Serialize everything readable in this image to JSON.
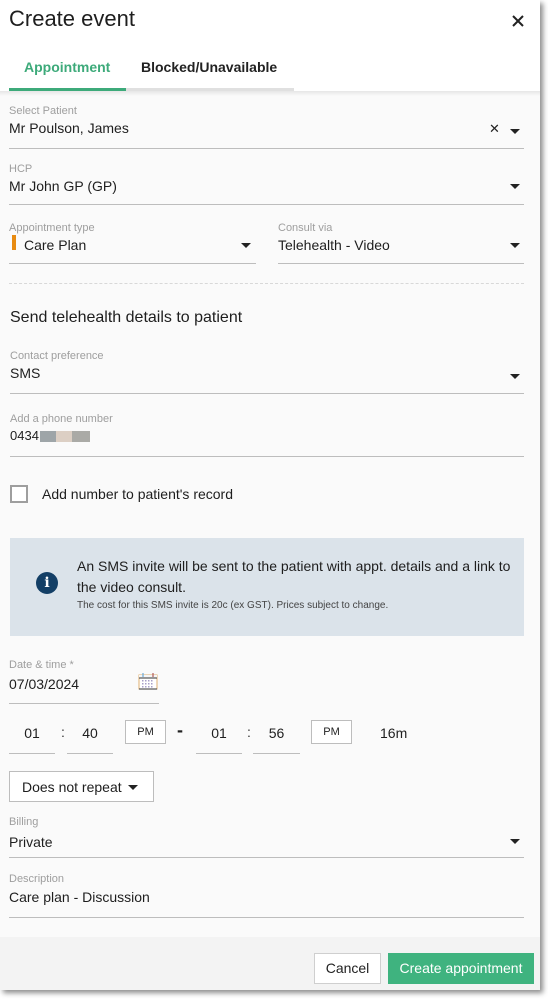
{
  "dialog": {
    "title": "Create event",
    "close_icon": "close-icon"
  },
  "tabs": [
    {
      "label": "Appointment",
      "active": true
    },
    {
      "label": "Blocked/Unavailable",
      "active": false
    }
  ],
  "form": {
    "patient": {
      "label": "Select Patient",
      "value": "Mr Poulson, James"
    },
    "hcp": {
      "label": "HCP",
      "value": "Mr John GP (GP)"
    },
    "appointment_type": {
      "label": "Appointment type",
      "value": "Care Plan",
      "color": "#e88b12"
    },
    "consult_via": {
      "label": "Consult via",
      "value": "Telehealth - Video"
    },
    "telehealth_section_title": "Send telehealth details to patient",
    "contact_preference": {
      "label": "Contact preference",
      "value": "SMS"
    },
    "phone": {
      "label": "Add a phone number",
      "value": "0434"
    },
    "add_to_record": {
      "label": "Add number to patient's record",
      "checked": false
    },
    "info": {
      "icon": "info-icon",
      "message": "An SMS invite will be sent to the patient with appt. details and a link to the video consult.",
      "note": "The cost for this SMS invite is 20c (ex GST). Prices subject to change."
    },
    "date_time": {
      "label": "Date & time *",
      "value": "07/03/2024"
    },
    "start_time": {
      "hour": "01",
      "minute": "40",
      "ampm": "PM"
    },
    "end_time": {
      "hour": "01",
      "minute": "56",
      "ampm": "PM"
    },
    "time_separator": ":",
    "range_separator": "-",
    "duration": "16m",
    "repeat": {
      "value": "Does not repeat"
    },
    "billing": {
      "label": "Billing",
      "value": "Private"
    },
    "description": {
      "label": "Description",
      "value": "Care plan - Discussion"
    }
  },
  "footer": {
    "cancel_label": "Cancel",
    "create_label": "Create appointment"
  },
  "colors": {
    "accent": "#3daa7a",
    "primary_button": "#3fb37f",
    "info_bg": "#dbe3ea",
    "info_icon": "#133f66"
  }
}
